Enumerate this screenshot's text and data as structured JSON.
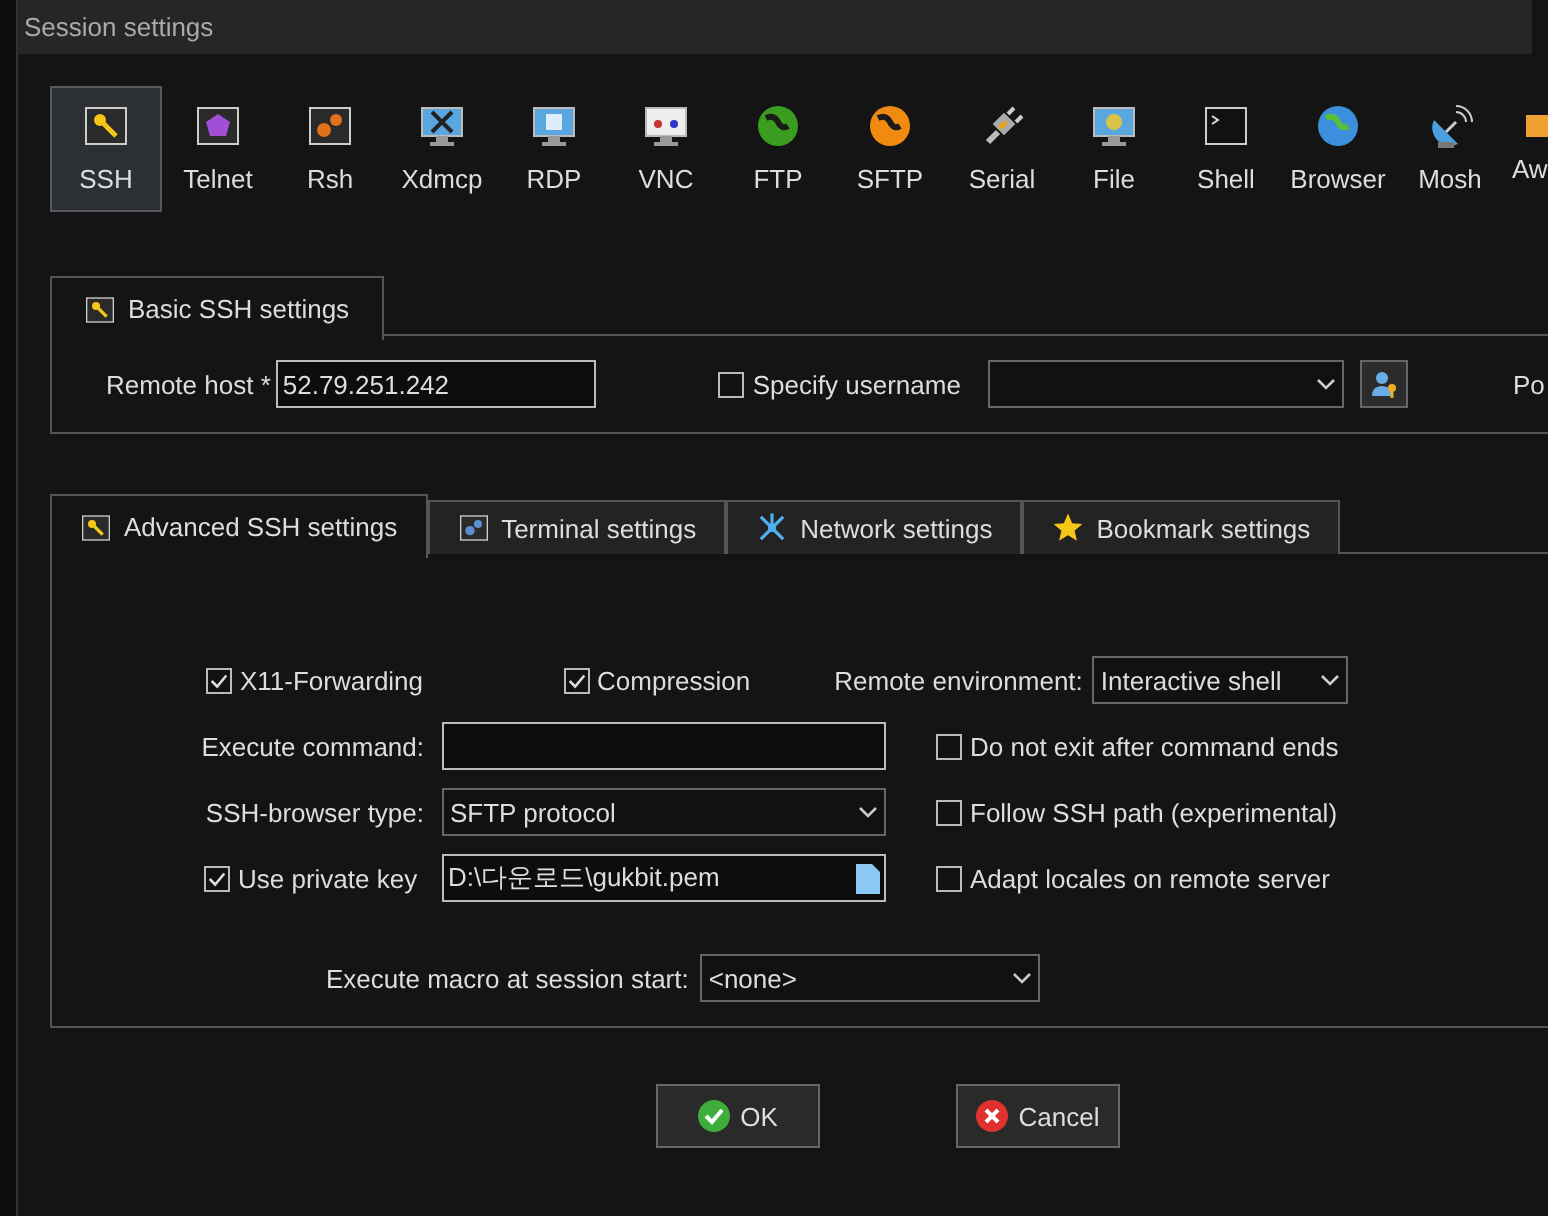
{
  "window": {
    "title": "Session settings"
  },
  "session_types": [
    {
      "label": "SSH",
      "selected": true
    },
    {
      "label": "Telnet",
      "selected": false
    },
    {
      "label": "Rsh",
      "selected": false
    },
    {
      "label": "Xdmcp",
      "selected": false
    },
    {
      "label": "RDP",
      "selected": false
    },
    {
      "label": "VNC",
      "selected": false
    },
    {
      "label": "FTP",
      "selected": false
    },
    {
      "label": "SFTP",
      "selected": false
    },
    {
      "label": "Serial",
      "selected": false
    },
    {
      "label": "File",
      "selected": false
    },
    {
      "label": "Shell",
      "selected": false
    },
    {
      "label": "Browser",
      "selected": false
    },
    {
      "label": "Mosh",
      "selected": false
    },
    {
      "label": "Aw",
      "selected": false
    }
  ],
  "basic": {
    "tab": "Basic SSH settings",
    "remote_host_label": "Remote host *",
    "remote_host": "52.79.251.242",
    "specify_username": {
      "label": "Specify username",
      "checked": false
    },
    "port_label": "Po"
  },
  "advanced_tabs": [
    {
      "label": "Advanced SSH settings",
      "selected": true
    },
    {
      "label": "Terminal settings",
      "selected": false
    },
    {
      "label": "Network settings",
      "selected": false
    },
    {
      "label": "Bookmark settings",
      "selected": false
    }
  ],
  "advanced": {
    "x11_forwarding": {
      "label": "X11-Forwarding",
      "checked": true
    },
    "compression": {
      "label": "Compression",
      "checked": true
    },
    "remote_environment": {
      "label": "Remote environment:",
      "value": "Interactive shell"
    },
    "execute_command": {
      "label": "Execute command:"
    },
    "do_not_exit": {
      "label": "Do not exit after command ends",
      "checked": false
    },
    "ssh_browser_type": {
      "label": "SSH-browser type:",
      "value": "SFTP protocol"
    },
    "follow_ssh_path": {
      "label": "Follow SSH path (experimental)",
      "checked": false
    },
    "use_private_key": {
      "label": "Use private key",
      "checked": true,
      "value": "D:\\다운로드\\gukbit.pem"
    },
    "adapt_locales": {
      "label": "Adapt locales on remote server",
      "checked": false
    },
    "execute_macro": {
      "label": "Execute macro at session start:",
      "value": "<none>"
    }
  },
  "buttons": [
    {
      "label": "OK",
      "kind": "ok"
    },
    {
      "label": "Cancel",
      "kind": "cancel"
    }
  ]
}
